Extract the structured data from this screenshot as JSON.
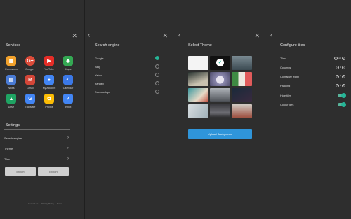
{
  "services": {
    "title": "Services",
    "apps": [
      {
        "label": "Extensions",
        "icon": "extensions-icon",
        "color": "#f2a22c",
        "glyph": "▦"
      },
      {
        "label": "Google+",
        "icon": "google-plus-icon",
        "color": "#dd4b39",
        "glyph": "G+"
      },
      {
        "label": "YouTube",
        "icon": "youtube-icon",
        "color": "#e52d27",
        "glyph": "▶"
      },
      {
        "label": "Maps",
        "icon": "maps-icon",
        "color": "#34a853",
        "glyph": "◆"
      },
      {
        "label": "News",
        "icon": "news-icon",
        "color": "#4a7bd4",
        "glyph": "▤"
      },
      {
        "label": "Gmail",
        "icon": "gmail-icon",
        "color": "#d44638",
        "glyph": "M"
      },
      {
        "label": "My Account",
        "icon": "account-icon",
        "color": "#4285f4",
        "glyph": "●"
      },
      {
        "label": "Calendar",
        "icon": "calendar-icon",
        "color": "#3b78e7",
        "glyph": "31"
      },
      {
        "label": "Drive",
        "icon": "drive-icon",
        "color": "#1fa463",
        "glyph": "▲"
      },
      {
        "label": "Translate",
        "icon": "translate-icon",
        "color": "#4285f4",
        "glyph": "G"
      },
      {
        "label": "Photos",
        "icon": "photos-icon",
        "color": "#fbbc05",
        "glyph": "✿"
      },
      {
        "label": "Inbox",
        "icon": "inbox-icon",
        "color": "#4285f4",
        "glyph": "✓"
      }
    ]
  },
  "settings": {
    "title": "Settings",
    "items": [
      {
        "label": "Search engine"
      },
      {
        "label": "Theme"
      },
      {
        "label": "Tiles"
      }
    ],
    "import_label": "Import",
    "export_label": "Export"
  },
  "footer": {
    "links": [
      "Contact us",
      "Privacy Policy",
      "Terms"
    ]
  },
  "search_engine": {
    "title": "Search engine",
    "engines": [
      {
        "label": "Google",
        "selected": true
      },
      {
        "label": "Bing",
        "selected": false
      },
      {
        "label": "Yahoo",
        "selected": false
      },
      {
        "label": "Yandex",
        "selected": false
      },
      {
        "label": "Duckduckgo",
        "selected": false
      }
    ]
  },
  "theme": {
    "title": "Select Theme",
    "upload_label": "Upload Background",
    "thumbs": [
      {
        "color": "#f4f4f4",
        "selected": false
      },
      {
        "color": "#111111",
        "selected": true
      },
      {
        "color": "#5f7580",
        "selected": false
      },
      {
        "color": "#26302d",
        "selected": false
      },
      {
        "color": "#b9b6cf",
        "selected": false
      },
      {
        "color": "#3f8a43",
        "selected": false
      },
      {
        "color": "#3d9aa0",
        "selected": false
      },
      {
        "color": "#6f7378",
        "selected": false
      },
      {
        "color": "#1a2a3a",
        "selected": false
      },
      {
        "color": "#d7dde0",
        "selected": false
      },
      {
        "color": "#3a3a3f",
        "selected": false
      },
      {
        "color": "#cfc9c2",
        "selected": false
      }
    ]
  },
  "tiles": {
    "title": "Configure tiles",
    "rows": [
      {
        "label": "Tiles",
        "value": "10",
        "kind": "stepper"
      },
      {
        "label": "Columns",
        "value": "8",
        "kind": "stepper"
      },
      {
        "label": "Container width",
        "value": "7",
        "kind": "stepper"
      },
      {
        "label": "Padding",
        "value": "1",
        "kind": "stepper"
      },
      {
        "label": "Hide tiles",
        "value": "",
        "kind": "toggle"
      },
      {
        "label": "Colour tiles",
        "value": "",
        "kind": "toggle"
      }
    ]
  },
  "icons": {
    "close": "✕",
    "back": "‹",
    "chevron": "›",
    "minus": "−",
    "plus": "+",
    "check": "✓"
  }
}
